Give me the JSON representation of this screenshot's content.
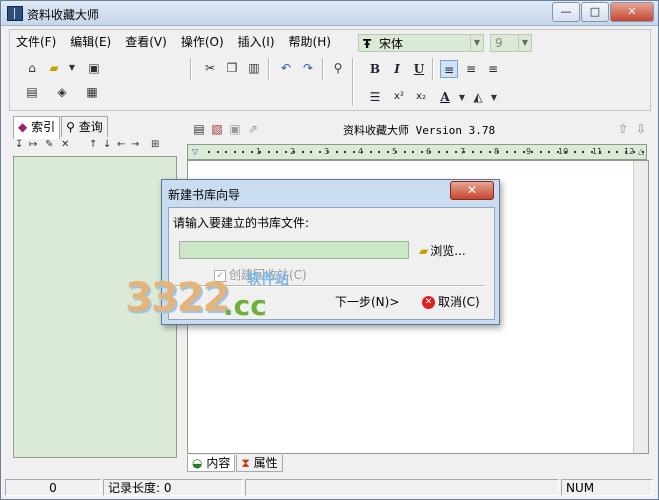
{
  "window": {
    "title": "资料收藏大师",
    "min": "—",
    "max": "□",
    "close": "✕"
  },
  "menu": [
    "文件(F)",
    "编辑(E)",
    "查看(V)",
    "操作(O)",
    "插入(I)",
    "帮助(H)"
  ],
  "format": {
    "font": "宋体",
    "size": "9",
    "bold": "B",
    "italic": "I",
    "underline": "U",
    "super": "x²",
    "sub": "x₂"
  },
  "left_panel": {
    "tabs": [
      "索引",
      "查询"
    ]
  },
  "right_panel": {
    "doc_title": "资料收藏大师 Version 3.78",
    "bottom_tabs": [
      "内容",
      "属性"
    ],
    "ruler": [
      "1",
      "2",
      "3",
      "4",
      "5",
      "6",
      "7",
      "8",
      "9",
      "10",
      "11",
      "12"
    ]
  },
  "status": {
    "cell1": "0",
    "cell2": "记录长度: 0",
    "cell3": "NUM"
  },
  "dialog": {
    "title": "新建书库向导",
    "close": "✕",
    "prompt": "请输入要建立的书库文件:",
    "input_value": "",
    "browse": "浏览...",
    "checkbox": "创建回收站(C)",
    "next": "下一步(N)>",
    "cancel": "取消(C)"
  },
  "watermark": {
    "big": "3322",
    "cc": ".cc",
    "small": "软件站"
  }
}
